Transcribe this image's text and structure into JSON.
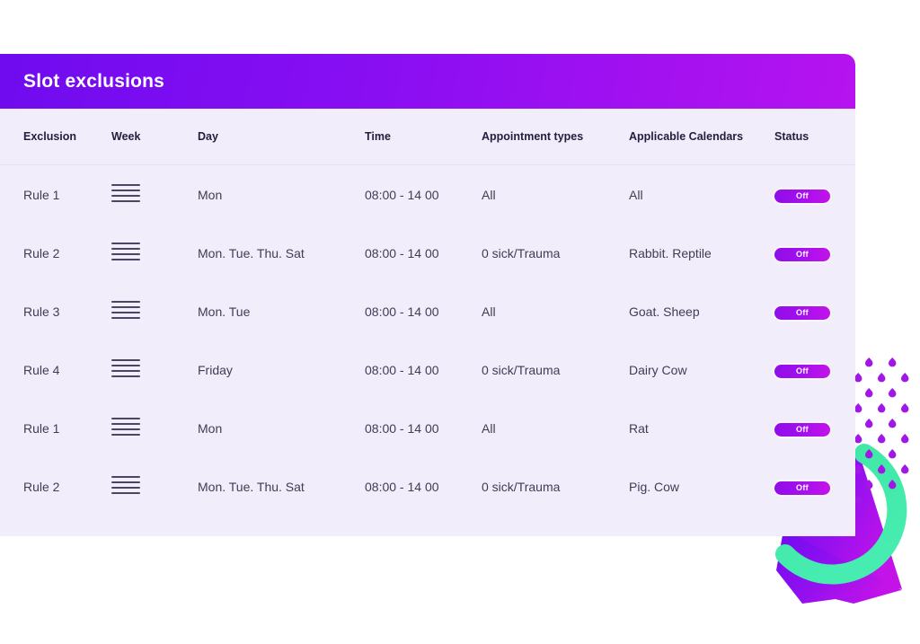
{
  "card": {
    "title": "Slot exclusions",
    "header_gradient_from": "#6f0bf0",
    "header_gradient_to": "#b613ef",
    "body_bg": "#f1edfb"
  },
  "table": {
    "columns": [
      {
        "key": "exclusion",
        "label": "Exclusion"
      },
      {
        "key": "week",
        "label": "Week"
      },
      {
        "key": "day",
        "label": "Day"
      },
      {
        "key": "time",
        "label": "Time"
      },
      {
        "key": "types",
        "label": "Appointment types"
      },
      {
        "key": "calendars",
        "label": "Applicable Calendars"
      },
      {
        "key": "status",
        "label": "Status"
      }
    ],
    "rows": [
      {
        "exclusion": "Rule 1",
        "week_icon": "hamburger-lines-icon",
        "day": "Mon",
        "time": "08:00 - 14 00",
        "types": "All",
        "calendars": "All",
        "status": "Off"
      },
      {
        "exclusion": "Rule 2",
        "week_icon": "hamburger-lines-icon",
        "day": "Mon. Tue. Thu. Sat",
        "time": "08:00 - 14 00",
        "types": "0 sick/Trauma",
        "calendars": "Rabbit. Reptile",
        "status": "Off"
      },
      {
        "exclusion": "Rule 3",
        "week_icon": "hamburger-lines-icon",
        "day": "Mon. Tue",
        "time": "08:00 - 14 00",
        "types": "All",
        "calendars": "Goat. Sheep",
        "status": "Off"
      },
      {
        "exclusion": "Rule 4",
        "week_icon": "hamburger-lines-icon",
        "day": "Friday",
        "time": "08:00 - 14 00",
        "types": "0 sick/Trauma",
        "calendars": "Dairy Cow",
        "status": "Off"
      },
      {
        "exclusion": "Rule 1",
        "week_icon": "hamburger-lines-icon",
        "day": "Mon",
        "time": "08:00 - 14 00",
        "types": "All",
        "calendars": "Rat",
        "status": "Off"
      },
      {
        "exclusion": "Rule 2",
        "week_icon": "hamburger-lines-icon",
        "day": "Mon. Tue. Thu. Sat",
        "time": "08:00 - 14 00",
        "types": "0 sick/Trauma",
        "calendars": "Pig. Cow",
        "status": "Off"
      }
    ]
  },
  "decoration": {
    "arc_color": "#3ee8a6",
    "arrow_gradient_from": "#6f0bf0",
    "arrow_gradient_to": "#c413e8",
    "dot_color": "#a117e6"
  }
}
